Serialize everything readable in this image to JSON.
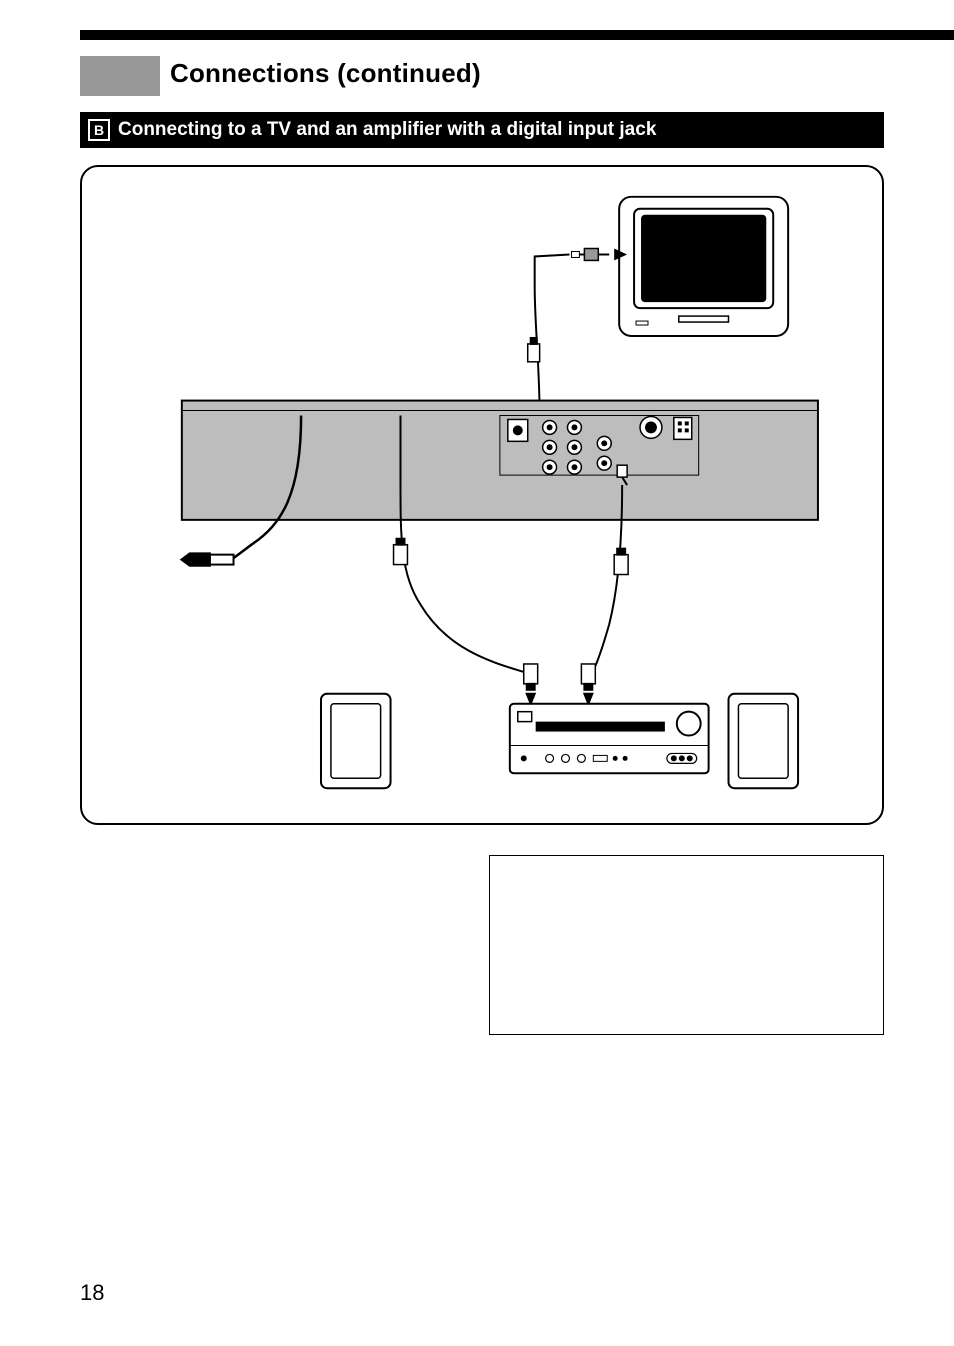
{
  "page": {
    "number": "18",
    "title": "Connections (continued)"
  },
  "subsection": {
    "badge_letter": "B",
    "heading": "Connecting to a TV and an amplifier with a digital input jack"
  }
}
